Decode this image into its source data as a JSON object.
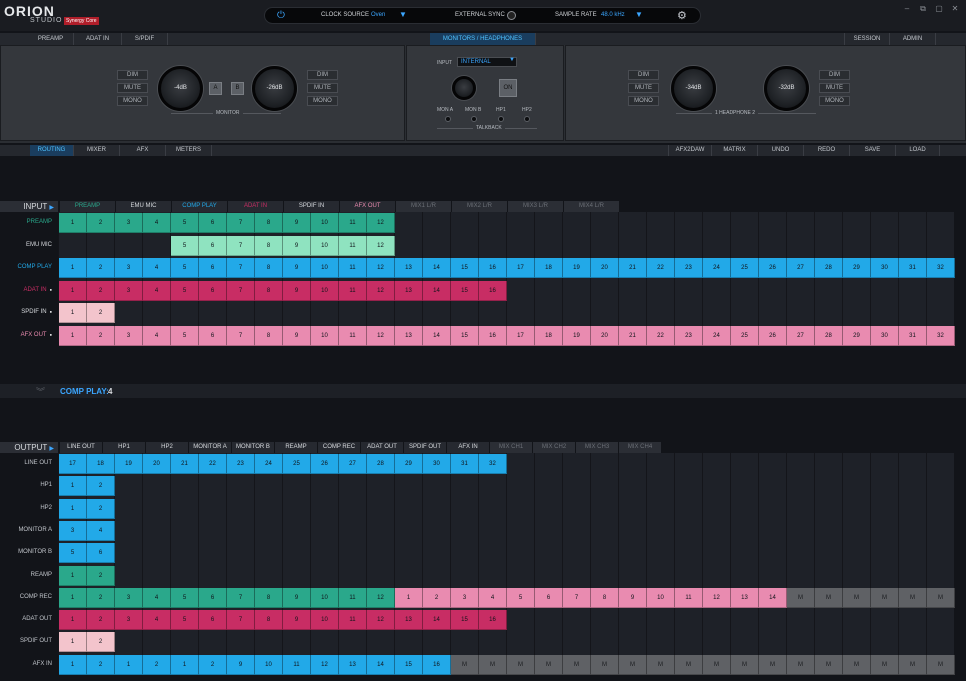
{
  "app": {
    "logo_main": "ORION",
    "logo_sub": "STUDIO",
    "logo_tag": "Synergy Core"
  },
  "toolbar": {
    "clock_source_label": "CLOCK SOURCE",
    "clock_source_value": "Oven",
    "external_sync_label": "EXTERNAL SYNC",
    "sample_rate_label": "SAMPLE RATE",
    "sample_rate_value": "48.0 kHz"
  },
  "window_controls": [
    "–",
    "⧉",
    "▢",
    "✕"
  ],
  "section_tabs": {
    "preamp": "PREAMP",
    "adat_in": "ADAT IN",
    "spdif": "S/PDIF",
    "monitors": "MONITORS / HEADPHONES",
    "session": "SESSION",
    "admin": "ADMIN"
  },
  "monitor": {
    "dim": "DIM",
    "mute": "MUTE",
    "mono": "MONO",
    "knob_a": "-4dB",
    "knob_b": "-26dB",
    "btn_a": "A",
    "btn_b": "B",
    "label": "MONITOR"
  },
  "talkback": {
    "input_label": "INPUT",
    "input_value": "INTERNAL",
    "on": "ON",
    "outs": [
      "MON A",
      "MON B",
      "HP1",
      "HP2"
    ],
    "label": "TALKBACK"
  },
  "headphone": {
    "dim": "DIM",
    "mute": "MUTE",
    "mono": "MONO",
    "knob_1": "-34dB",
    "knob_2": "-32dB",
    "label": "1 HEADPHONE 2"
  },
  "nav_tabs": {
    "routing": "ROUTING",
    "mixer": "MIXER",
    "afx": "AFX",
    "meters": "METERS",
    "afx2daw": "AFX2DAW",
    "matrix": "MATRIX",
    "undo": "UNDO",
    "redo": "REDO",
    "save": "SAVE",
    "load": "LOAD"
  },
  "input_section": {
    "label": "INPUT",
    "groups": [
      "PREAMP",
      "EMU MIC",
      "COMP PLAY",
      "ADAT IN",
      "SPDIF IN",
      "AFX OUT",
      "MIX1 L/R",
      "MIX2 L/R",
      "MIX3 L/R",
      "MIX4 L/R"
    ],
    "rows": [
      {
        "name": "PREAMP",
        "start": 0,
        "cells": [
          "1",
          "2",
          "3",
          "4",
          "5",
          "6",
          "7",
          "8",
          "9",
          "10",
          "11",
          "12"
        ]
      },
      {
        "name": "EMU MIC",
        "start": 4,
        "cells": [
          "5",
          "6",
          "7",
          "8",
          "9",
          "10",
          "11",
          "12"
        ]
      },
      {
        "name": "COMP PLAY",
        "start": 0,
        "cells": [
          "1",
          "2",
          "3",
          "4",
          "5",
          "6",
          "7",
          "8",
          "9",
          "10",
          "11",
          "12",
          "13",
          "14",
          "15",
          "16",
          "17",
          "18",
          "19",
          "20",
          "21",
          "22",
          "23",
          "24",
          "25",
          "26",
          "27",
          "28",
          "29",
          "30",
          "31",
          "32"
        ]
      },
      {
        "name": "ADAT IN",
        "start": 0,
        "cells": [
          "1",
          "2",
          "3",
          "4",
          "5",
          "6",
          "7",
          "8",
          "9",
          "10",
          "11",
          "12",
          "13",
          "14",
          "15",
          "16"
        ]
      },
      {
        "name": "SPDIF IN",
        "start": 0,
        "cells": [
          "1",
          "2"
        ]
      },
      {
        "name": "AFX OUT",
        "start": 0,
        "cells": [
          "1",
          "2",
          "3",
          "4",
          "5",
          "6",
          "7",
          "8",
          "9",
          "10",
          "11",
          "12",
          "13",
          "14",
          "15",
          "16",
          "17",
          "18",
          "19",
          "20",
          "21",
          "22",
          "23",
          "24",
          "25",
          "26",
          "27",
          "28",
          "29",
          "30",
          "31",
          "32"
        ]
      }
    ]
  },
  "status": {
    "label": "COMP PLAY:",
    "value": "4"
  },
  "output_section": {
    "label": "OUTPUT",
    "groups": [
      "LINE OUT",
      "HP1",
      "HP2",
      "MONITOR A",
      "MONITOR B",
      "REAMP",
      "COMP REC",
      "ADAT OUT",
      "SPDIF OUT",
      "AFX IN",
      "MIX CH1",
      "MIX CH2",
      "MIX CH3",
      "MIX CH4"
    ],
    "rows": [
      {
        "name": "LINE OUT",
        "cells": [
          "17",
          "18",
          "19",
          "20",
          "21",
          "22",
          "23",
          "24",
          "25",
          "26",
          "27",
          "28",
          "29",
          "30",
          "31",
          "32"
        ]
      },
      {
        "name": "HP1",
        "cells": [
          "1",
          "2"
        ]
      },
      {
        "name": "HP2",
        "cells": [
          "1",
          "2"
        ]
      },
      {
        "name": "MONITOR A",
        "cells": [
          "3",
          "4"
        ]
      },
      {
        "name": "MONITOR B",
        "cells": [
          "5",
          "6"
        ]
      },
      {
        "name": "REAMP",
        "cells": [
          "1",
          "2"
        ]
      },
      {
        "name": "COMP REC",
        "cells": [
          "1",
          "2",
          "3",
          "4",
          "5",
          "6",
          "7",
          "8",
          "9",
          "10",
          "11",
          "12",
          "1",
          "2",
          "3",
          "4",
          "5",
          "6",
          "7",
          "8",
          "9",
          "10",
          "11",
          "12",
          "13",
          "14",
          "M",
          "M",
          "M",
          "M",
          "M",
          "M"
        ]
      },
      {
        "name": "ADAT OUT",
        "cells": [
          "1",
          "2",
          "3",
          "4",
          "5",
          "6",
          "7",
          "8",
          "9",
          "10",
          "11",
          "12",
          "13",
          "14",
          "15",
          "16"
        ]
      },
      {
        "name": "SPDIF OUT",
        "cells": [
          "1",
          "2"
        ]
      },
      {
        "name": "AFX IN",
        "cells": [
          "1",
          "2",
          "1",
          "2",
          "1",
          "2",
          "9",
          "10",
          "11",
          "12",
          "13",
          "14",
          "15",
          "16",
          "M",
          "M",
          "M",
          "M",
          "M",
          "M",
          "M",
          "M",
          "M",
          "M",
          "M",
          "M",
          "M",
          "M",
          "M",
          "M",
          "M",
          "M"
        ]
      }
    ]
  },
  "colors": {
    "preamp": "#2aa88b",
    "emumic": "#8fe3c0",
    "compplay": "#22a9e8",
    "adat": "#c82d64",
    "spdif": "#f3c4cc",
    "afx": "#e98bb0",
    "mute": "#5f6165",
    "accent": "#1fb3ff"
  }
}
